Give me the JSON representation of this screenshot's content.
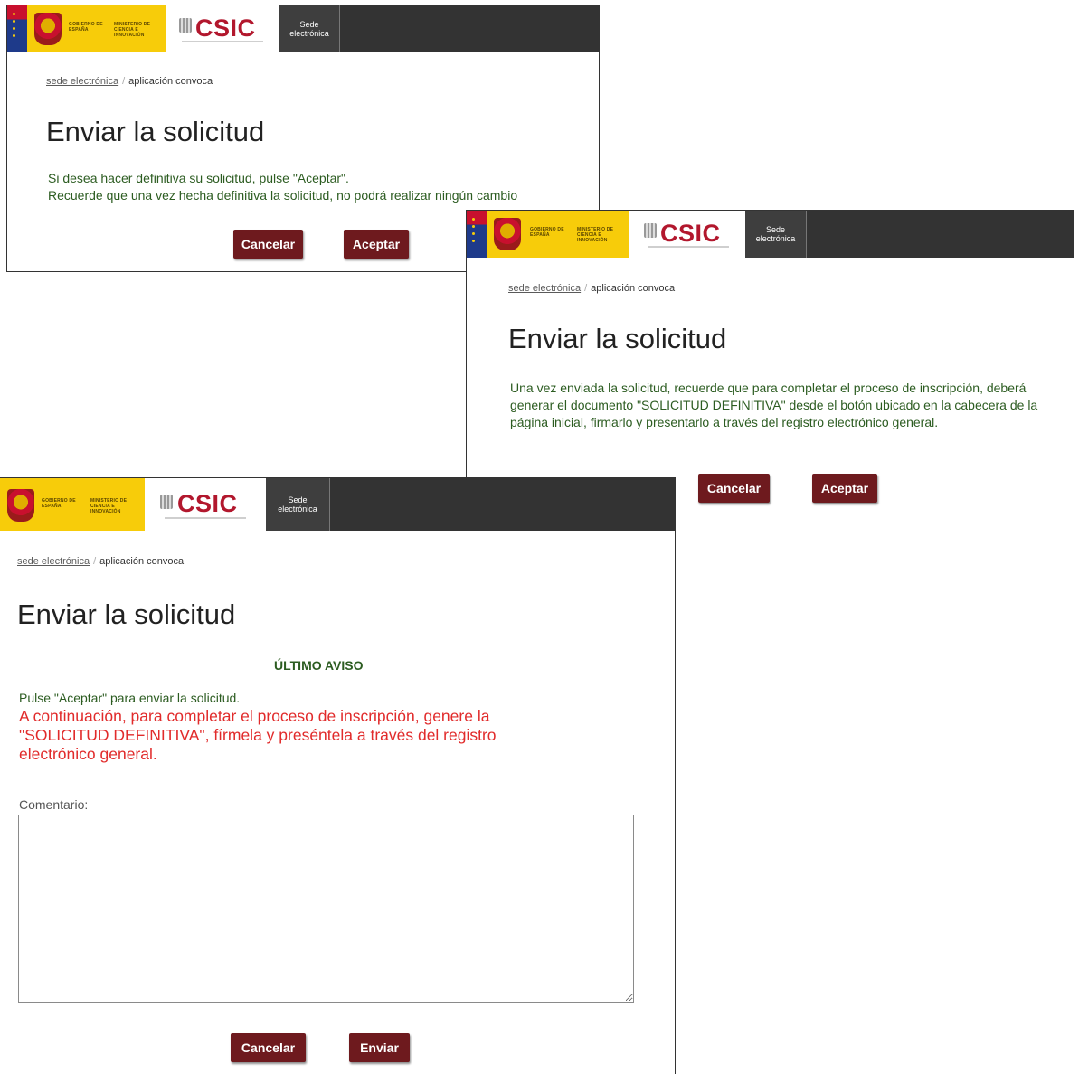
{
  "brand": {
    "gov_text_1": "GOBIERNO DE ESPAÑA",
    "gov_text_2": "MINISTERIO DE CIENCIA E INNOVACIÓN",
    "csic": "CSIC",
    "sede_line1": "Sede",
    "sede_line2": "electrónica"
  },
  "colors": {
    "header_bg": "#333333",
    "gov_yellow": "#f7cc0a",
    "csic_red": "#b2172d",
    "button_bg": "#6e1a1e",
    "message_green": "#2c5c21",
    "warning_red": "#e12b2b"
  },
  "breadcrumb": {
    "link": "sede electrónica",
    "separator": "/",
    "current": "aplicación convoca"
  },
  "screen1": {
    "title": "Enviar la solicitud",
    "line1": "Si desea hacer definitiva su solicitud, pulse \"Aceptar\".",
    "line2": "Recuerde que una vez hecha definitiva la solicitud, no podrá realizar ningún cambio",
    "cancel": "Cancelar",
    "accept": "Aceptar"
  },
  "screen2": {
    "title": "Enviar la solicitud",
    "message": "Una vez enviada la solicitud, recuerde que para completar el proceso de inscripción, deberá generar el documento \"SOLICITUD DEFINITIVA\" desde el botón ubicado en la cabecera de la página inicial, firmarlo y presentarlo a través del registro electrónico general.",
    "cancel": "Cancelar",
    "accept": "Aceptar"
  },
  "screen3": {
    "title": "Enviar la solicitud",
    "last_notice": "ÚLTIMO AVISO",
    "instruction": "Pulse \"Aceptar\" para enviar la solicitud.",
    "warning": "A continuación, para completar el proceso de inscripción, genere la \"SOLICITUD DEFINITIVA\", fírmela y preséntela a través del registro electrónico general.",
    "comment_label": "Comentario:",
    "comment_value": "",
    "cancel": "Cancelar",
    "send": "Enviar"
  }
}
